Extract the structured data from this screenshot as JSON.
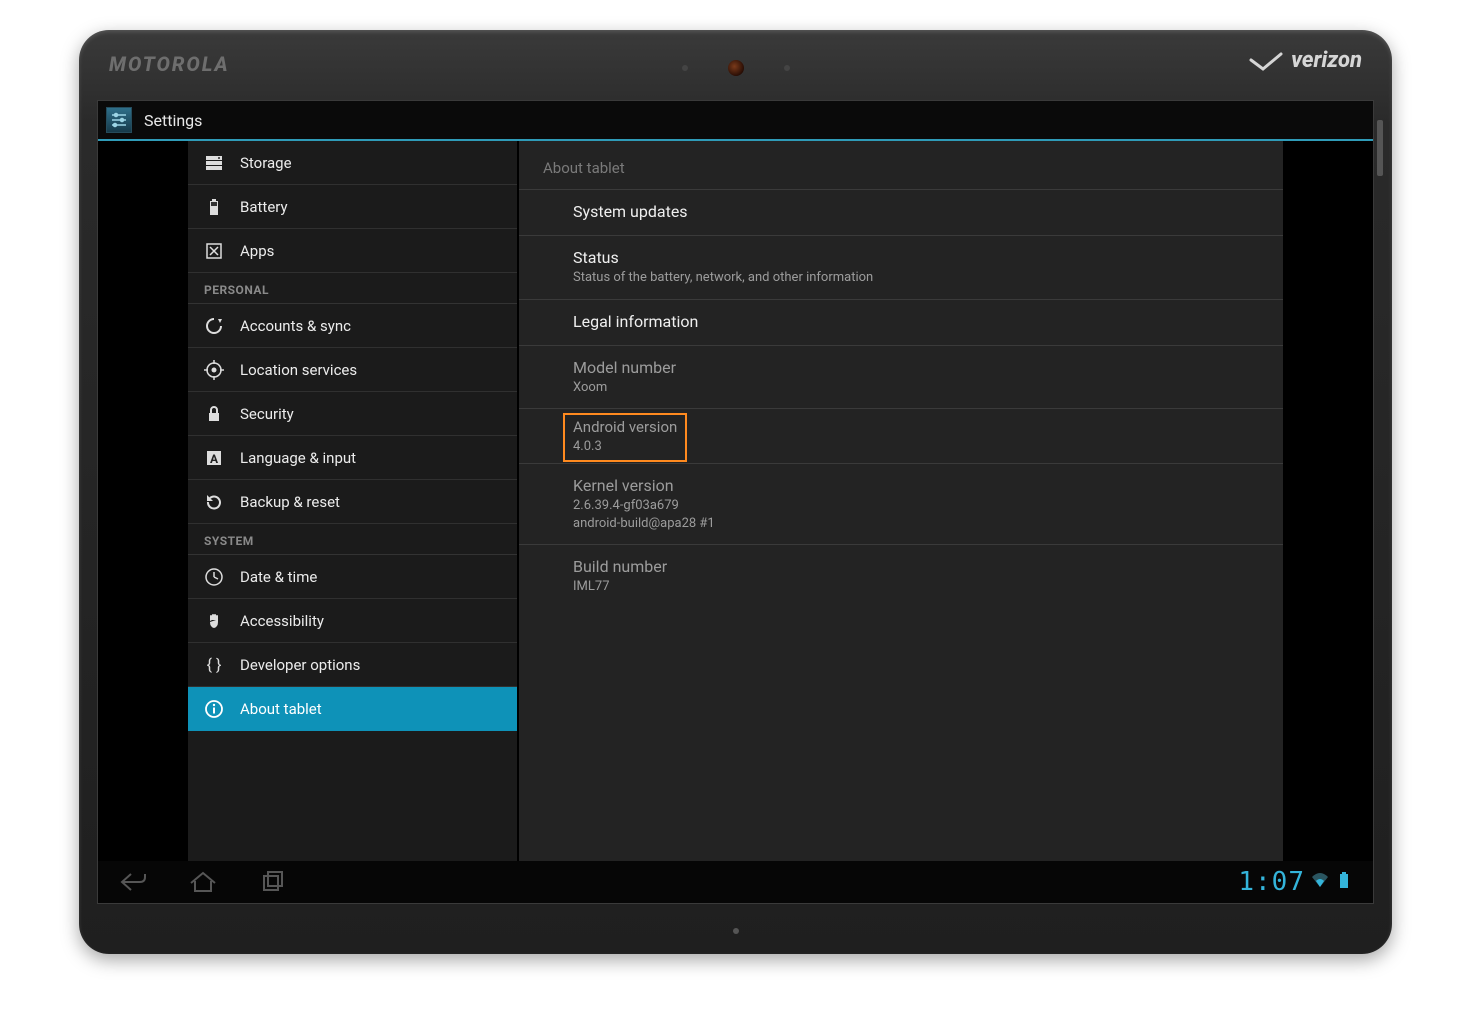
{
  "brand_left": "MOTOROLA",
  "brand_right": "verizon",
  "action_bar_title": "Settings",
  "sidebar": {
    "items": [
      {
        "label": "Storage",
        "section": null
      },
      {
        "label": "Battery",
        "section": null
      },
      {
        "label": "Apps",
        "section": null
      }
    ],
    "section_personal": "PERSONAL",
    "personal_items": [
      {
        "label": "Accounts & sync"
      },
      {
        "label": "Location services"
      },
      {
        "label": "Security"
      },
      {
        "label": "Language & input"
      },
      {
        "label": "Backup & reset"
      }
    ],
    "section_system": "SYSTEM",
    "system_items": [
      {
        "label": "Date & time"
      },
      {
        "label": "Accessibility"
      },
      {
        "label": "Developer options"
      },
      {
        "label": "About tablet"
      }
    ]
  },
  "detail": {
    "header": "About tablet",
    "system_updates": "System updates",
    "status_title": "Status",
    "status_sub": "Status of the battery, network, and other information",
    "legal": "Legal information",
    "model_title": "Model number",
    "model_value": "Xoom",
    "android_title": "Android version",
    "android_value": "4.0.3",
    "kernel_title": "Kernel version",
    "kernel_line1": "2.6.39.4-gf03a679",
    "kernel_line2": "android-build@apa28 #1",
    "build_title": "Build number",
    "build_value": "IML77"
  },
  "clock": "1:07"
}
